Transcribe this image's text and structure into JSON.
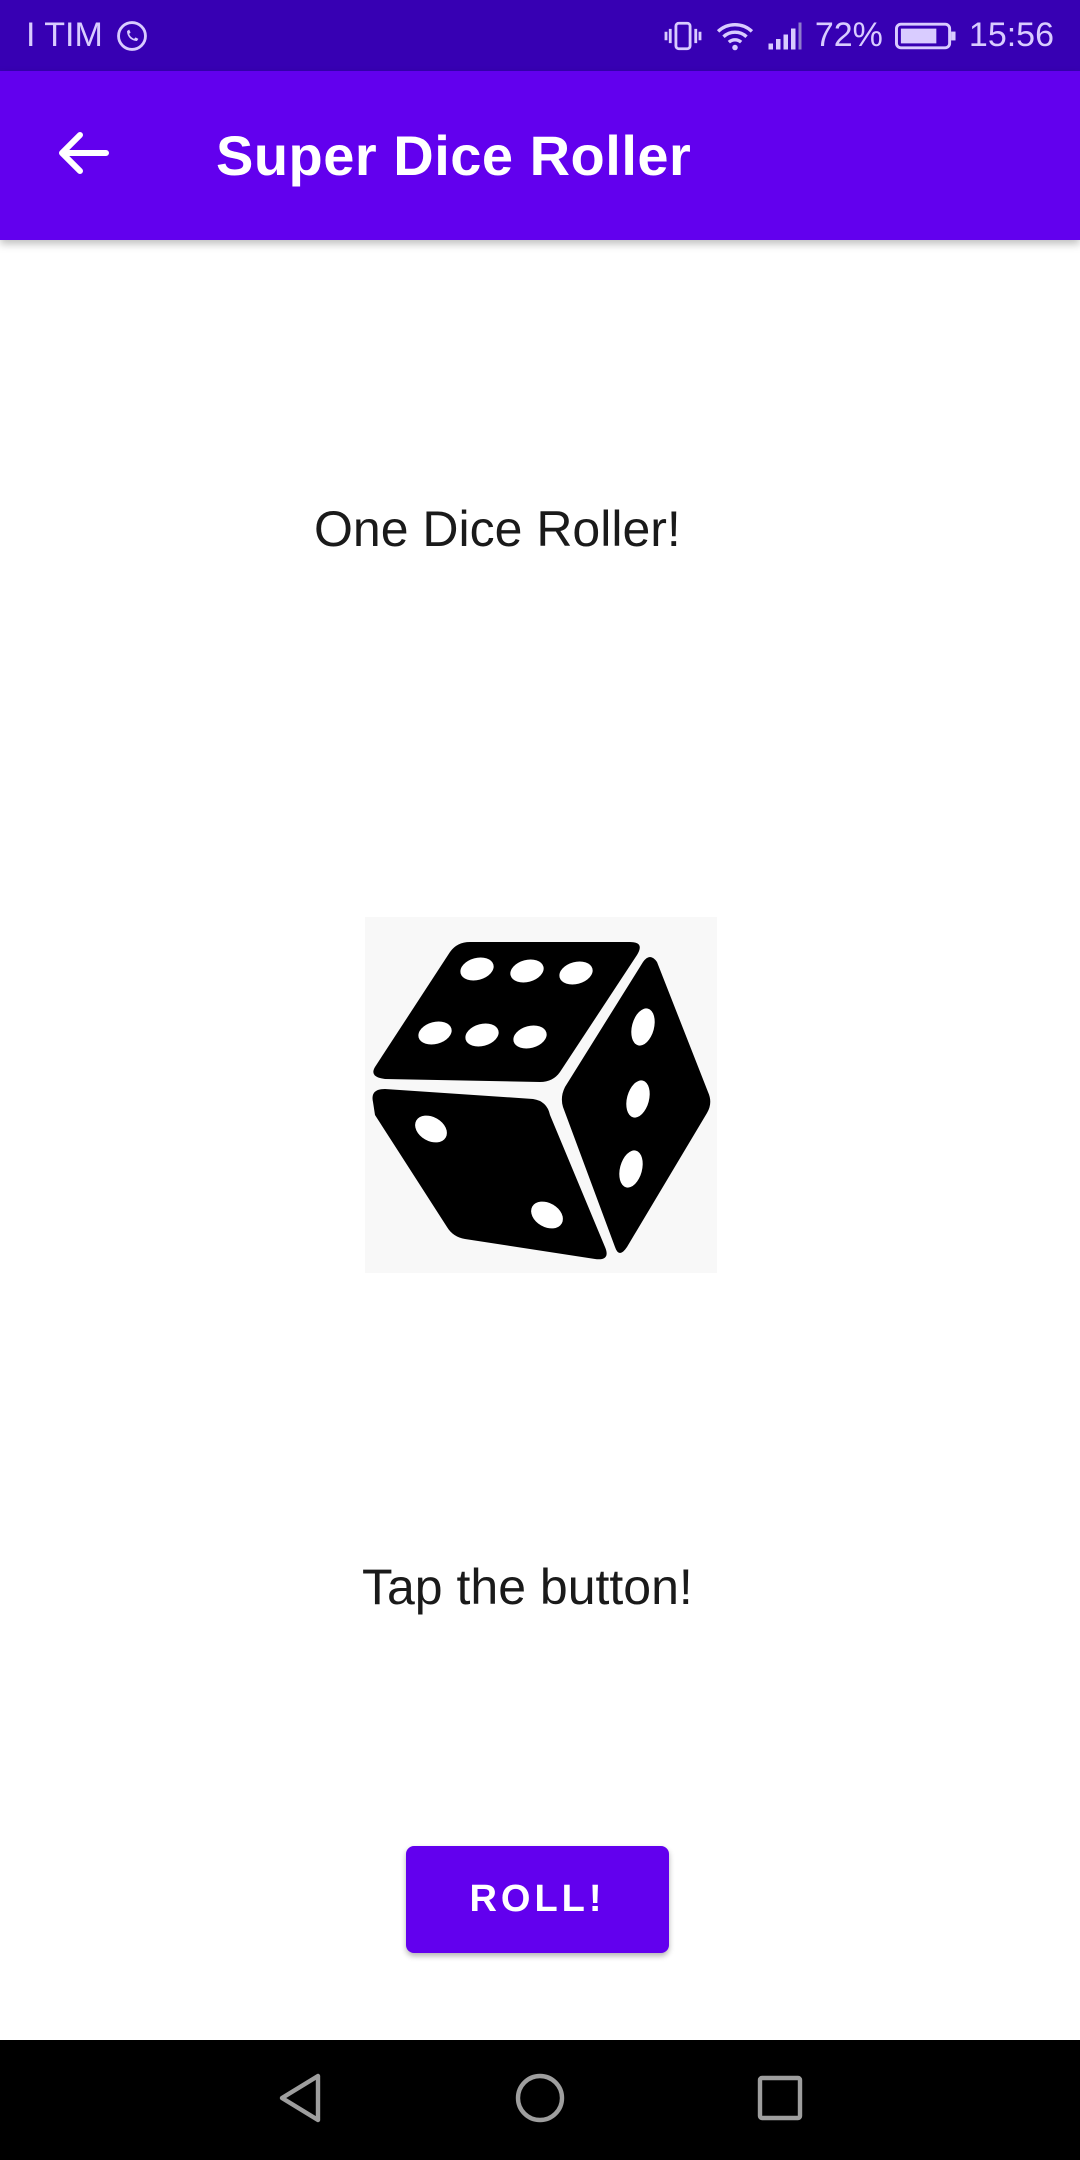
{
  "status_bar": {
    "carrier": "I TIM",
    "battery_percent": "72%",
    "time": "15:56",
    "icons": [
      "whatsapp-icon",
      "vibrate-icon",
      "wifi-icon",
      "signal-icon",
      "battery-icon"
    ]
  },
  "app_bar": {
    "title": "Super Dice Roller",
    "back_icon": "arrow-left-icon"
  },
  "main": {
    "heading": "One Dice Roller!",
    "dice_face_value": 6,
    "prompt": "Tap the button!",
    "roll_label": "ROLL!"
  },
  "nav_bar": {
    "icons": [
      "back-triangle-icon",
      "home-circle-icon",
      "recents-square-icon"
    ]
  },
  "colors": {
    "status_bar": "#3700b3",
    "app_bar": "#6200ee",
    "button": "#6200ee",
    "nav_bar": "#000000"
  }
}
